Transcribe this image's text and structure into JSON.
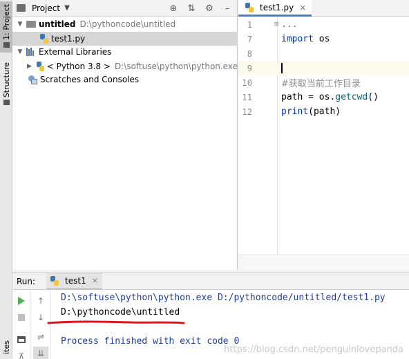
{
  "sidebar": {
    "project_tab": "1: Project",
    "structure_tab": "Structure",
    "favorites_tab": "ites"
  },
  "project_panel": {
    "title": "Project",
    "tree": [
      {
        "label": "untitled",
        "path": "D:\\pythoncode\\untitled"
      },
      {
        "label": "test1.py"
      },
      {
        "label": "External Libraries"
      },
      {
        "label": "< Python 3.8 >",
        "path": "D:\\softuse\\python\\python.exe"
      },
      {
        "label": "Scratches and Consoles"
      }
    ]
  },
  "editor": {
    "tab": "test1.py",
    "lines": [
      {
        "num": "1",
        "text": "..."
      },
      {
        "num": "7",
        "kw": "import",
        "rest": " os"
      },
      {
        "num": "8"
      },
      {
        "num": "9"
      },
      {
        "num": "10",
        "comment": "#获取当前工作目录"
      },
      {
        "num": "11",
        "pre": "path = os.",
        "fn": "getcwd",
        "post": "()"
      },
      {
        "num": "12",
        "kw": "print",
        "rest": "(path)"
      }
    ]
  },
  "run_panel": {
    "label": "Run:",
    "tab": "test1",
    "output": [
      "D:\\softuse\\python\\python.exe D:/pythoncode/untitled/test1.py",
      "D:\\pythoncode\\untitled",
      "Process finished with exit code 0"
    ],
    "watermark": "https://blog.csdn.net/penguinlovepanda"
  },
  "colors": {
    "keyword": "#0033b3",
    "function": "#00627a",
    "comment": "#8c8c8c",
    "console_blue": "#1f3e9a",
    "annotation_red": "#e0141e"
  }
}
